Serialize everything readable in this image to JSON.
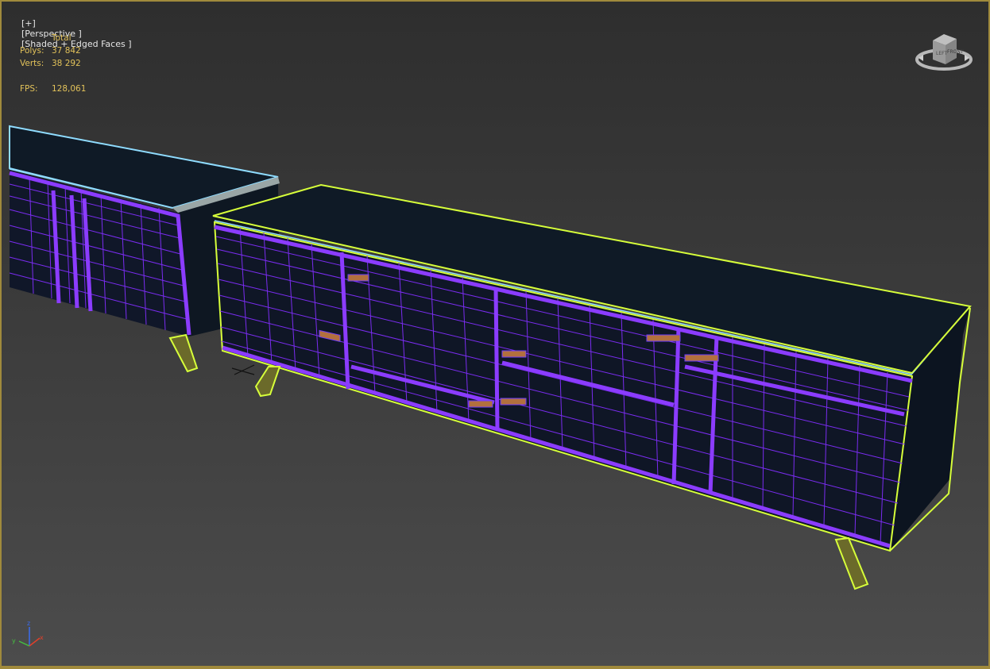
{
  "viewport": {
    "label": {
      "plus": "[+]",
      "view": "[Perspective ]",
      "shading": "[Shaded + Edged Faces ]"
    },
    "stats": {
      "header": "Total",
      "polys_label": "Polys:",
      "polys_value": "37 842",
      "verts_label": "Verts:",
      "verts_value": "38 292",
      "fps_label": "FPS:",
      "fps_value": "128,061"
    },
    "viewcube": {
      "icon": "viewcube-icon",
      "face_left": "LEFT",
      "face_front": "FRONT"
    },
    "axis_gizmo": {
      "x": "x",
      "y": "y",
      "z": "z"
    }
  },
  "colors": {
    "frame": "#a08a3c",
    "stats_text": "#e2c25a",
    "wire": "#7a2cf0",
    "selection": "#d7ff3a",
    "top_edge": "#7ed8ff",
    "body": "#0f1724"
  }
}
